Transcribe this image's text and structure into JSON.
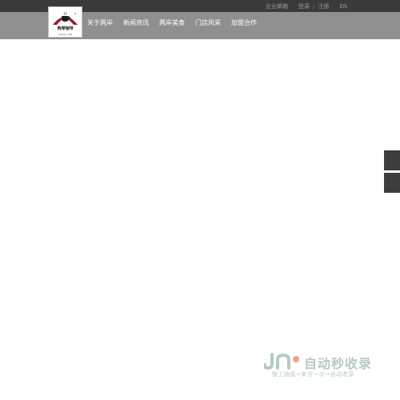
{
  "topbar": {
    "enterprise_mail": "企业邮箱",
    "login": "登录",
    "separator": "/",
    "register": "注册",
    "language": "EN"
  },
  "logo": {
    "text": "两岸咖啡",
    "subtext": "Liberty café",
    "icon": "coffee-cup-arch-logo"
  },
  "nav": {
    "items": [
      {
        "label": "关于两岸"
      },
      {
        "label": "新闻资讯"
      },
      {
        "label": "两岸美食"
      },
      {
        "label": "门店风采"
      },
      {
        "label": "加盟合作"
      }
    ]
  },
  "watermark": {
    "title": "自动秒收录",
    "subtitle": "敬上链接→来访一次→自动收录",
    "icon": "jm-logo-icon"
  },
  "colors": {
    "topbar_bg": "#3a3a3a",
    "navbar_bg": "#8f8f8f",
    "logo_arch": "#9b1b2a",
    "side_button": "#3d3d3d",
    "watermark_text": "#b7c9c3"
  }
}
